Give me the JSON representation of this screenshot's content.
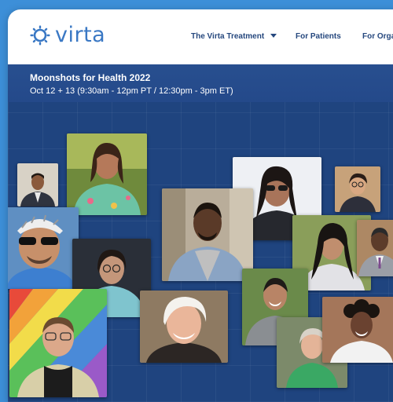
{
  "brand": {
    "name": "virta",
    "color": "#3a78c4"
  },
  "nav": {
    "items": [
      {
        "label": "The Virta Treatment",
        "has_dropdown": true
      },
      {
        "label": "For Patients",
        "has_dropdown": false
      },
      {
        "label": "For Organ",
        "has_dropdown": false
      }
    ],
    "dropdown_icon": "chevron-down-icon"
  },
  "banner": {
    "title": "Moonshots for Health 2022",
    "dates": "Oct 12 + 13 (9:30am - 12pm PT / 12:30pm - 3pm ET)"
  },
  "collage": {
    "photos": [
      {
        "name": "man-in-suit"
      },
      {
        "name": "woman-in-floral-dress"
      },
      {
        "name": "woman-with-sunglasses"
      },
      {
        "name": "woman-with-glasses-smiling"
      },
      {
        "name": "cyclist-with-helmet"
      },
      {
        "name": "man-in-denim-jacket"
      },
      {
        "name": "woman-with-long-dark-hair"
      },
      {
        "name": "man-in-gray-suit"
      },
      {
        "name": "woman-in-teal-shirt"
      },
      {
        "name": "man-with-rainbow-umbrella"
      },
      {
        "name": "older-woman-smiling"
      },
      {
        "name": "man-in-gray-tshirt"
      },
      {
        "name": "older-woman-in-green"
      },
      {
        "name": "woman-with-curly-hair"
      }
    ]
  }
}
